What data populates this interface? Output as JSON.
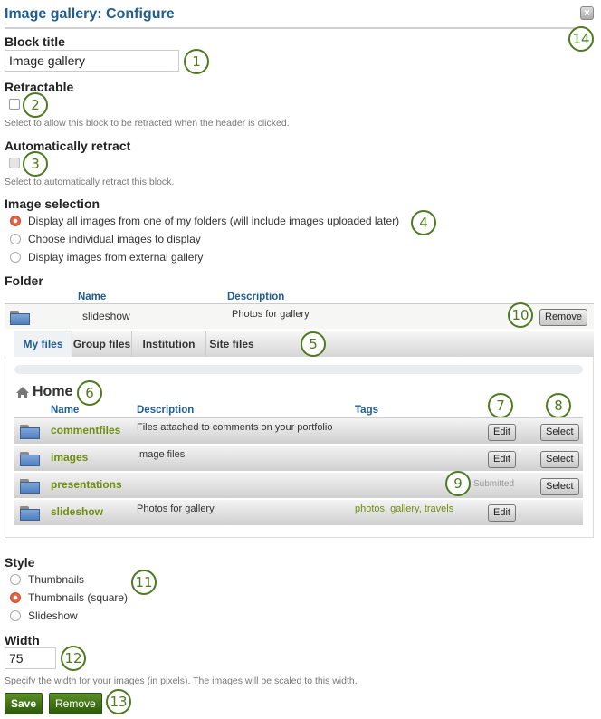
{
  "header": {
    "title": "Image gallery: Configure",
    "close_icon": "close-icon"
  },
  "block_title": {
    "label": "Block title",
    "value": "Image gallery"
  },
  "retractable": {
    "label": "Retractable",
    "checked": false,
    "description": "Select to allow this block to be retracted when the header is clicked."
  },
  "auto_retract": {
    "label": "Automatically retract",
    "checked": false,
    "disabled": true,
    "description": "Select to automatically retract this block."
  },
  "image_selection": {
    "label": "Image selection",
    "options": [
      {
        "label": "Display all images from one of my folders (will include images uploaded later)",
        "selected": true
      },
      {
        "label": "Choose individual images to display",
        "selected": false
      },
      {
        "label": "Display images from external gallery",
        "selected": false
      }
    ]
  },
  "folder": {
    "label": "Folder",
    "columns": {
      "name": "Name",
      "description": "Description"
    },
    "selected": {
      "icon": "folder-icon",
      "name": "slideshow",
      "description": "Photos for gallery",
      "remove_label": "Remove"
    }
  },
  "tabs": [
    {
      "label": "My files",
      "active": true
    },
    {
      "label": "Group files",
      "active": false
    },
    {
      "label": "Institution files",
      "active": false
    },
    {
      "label": "Site files",
      "active": false
    }
  ],
  "browser": {
    "home_label": "Home",
    "home_icon": "home-icon",
    "columns": {
      "name": "Name",
      "description": "Description",
      "tags": "Tags"
    },
    "rows": [
      {
        "name": "commentfiles",
        "description": "Files attached to comments on your portfolio",
        "tags": "",
        "edit": "Edit",
        "select": "Select",
        "status": ""
      },
      {
        "name": "images",
        "description": "Image files",
        "tags": "",
        "edit": "Edit",
        "select": "Select",
        "status": ""
      },
      {
        "name": "presentations",
        "description": "",
        "tags": "",
        "edit": "",
        "select": "Select",
        "status": "Submitted"
      },
      {
        "name": "slideshow",
        "description": "Photos for gallery",
        "tags": "photos, gallery, travels",
        "edit": "Edit",
        "select": "",
        "status": ""
      }
    ]
  },
  "style": {
    "label": "Style",
    "options": [
      {
        "label": "Thumbnails",
        "selected": false
      },
      {
        "label": "Thumbnails (square)",
        "selected": true
      },
      {
        "label": "Slideshow",
        "selected": false
      }
    ]
  },
  "width": {
    "label": "Width",
    "value": "75",
    "description": "Specify the width for your images (in pixels). The images will be scaled to this width."
  },
  "actions": {
    "save_label": "Save",
    "remove_label": "Remove"
  },
  "callouts": [
    "1",
    "2",
    "3",
    "4",
    "5",
    "6",
    "7",
    "8",
    "9",
    "10",
    "11",
    "12",
    "13",
    "14"
  ],
  "colors": {
    "title": "#1f5d91",
    "accent_green": "#4e7a21",
    "link_green": "#6e8e0f",
    "radio_selected": "#e8623f"
  }
}
